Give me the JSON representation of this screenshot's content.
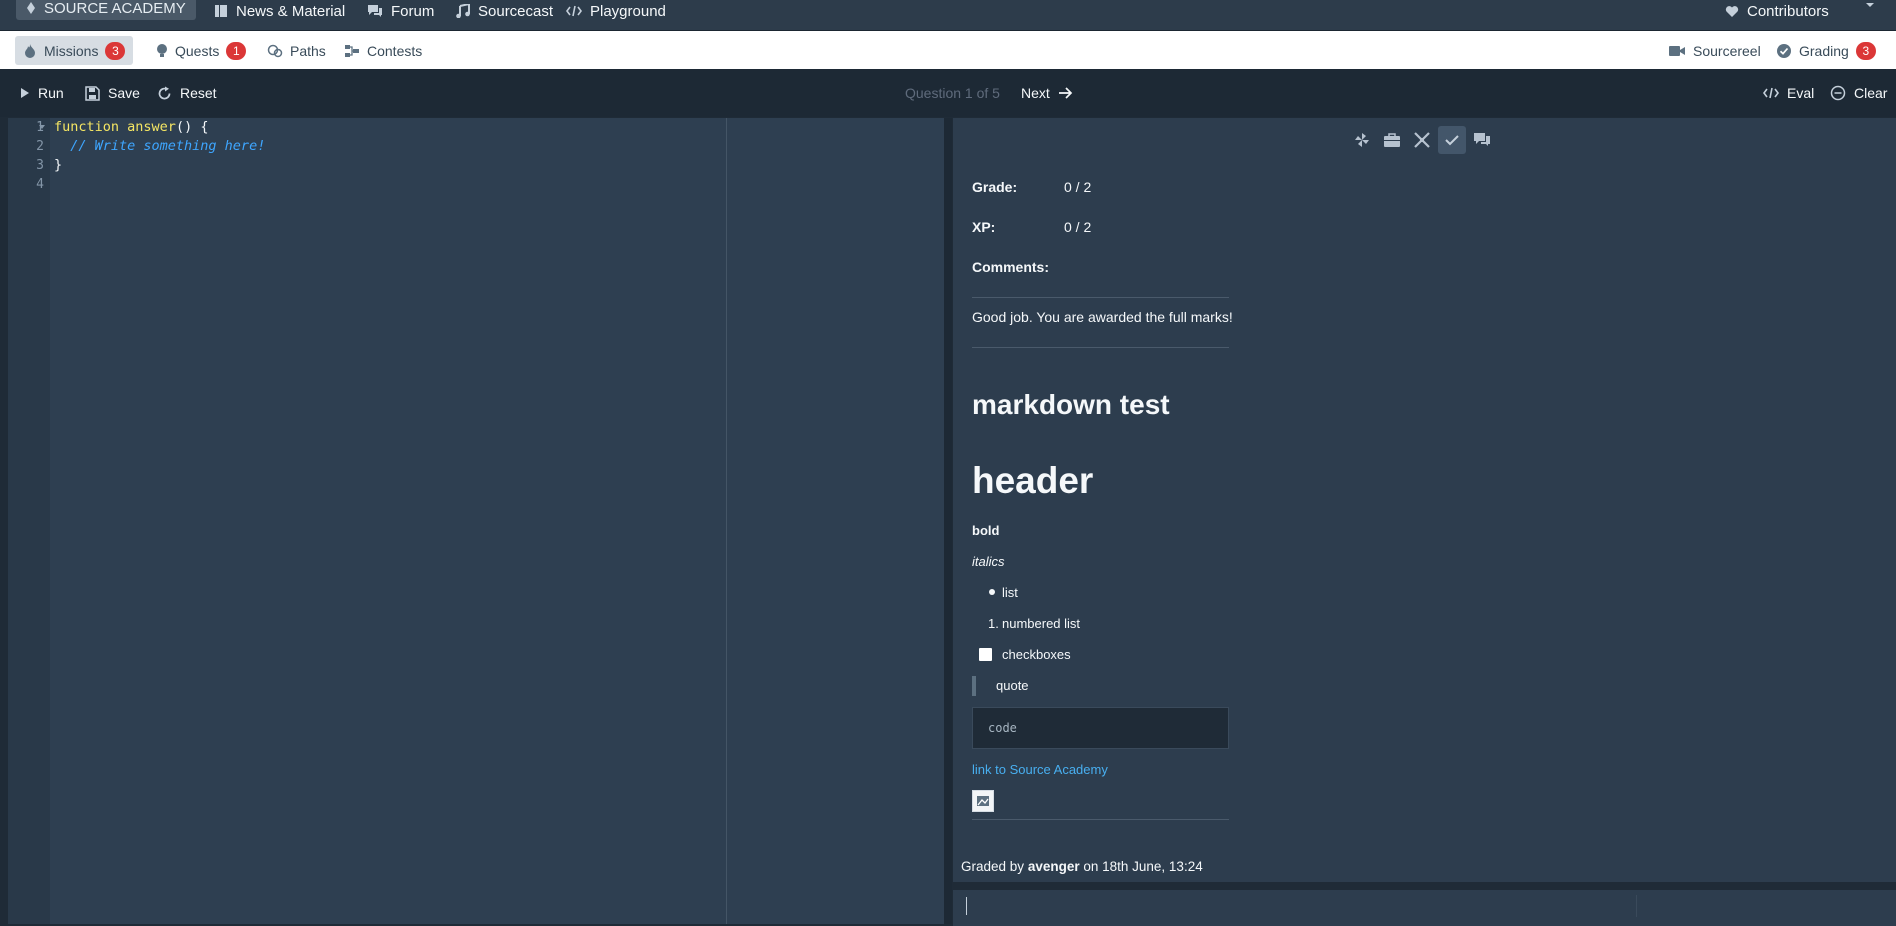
{
  "topnav": {
    "brand": "SOURCE ACADEMY",
    "items": [
      {
        "label": "News & Material"
      },
      {
        "label": "Forum"
      },
      {
        "label": "Sourcecast"
      },
      {
        "label": "Playground"
      }
    ],
    "contributors": "Contributors"
  },
  "subnav": {
    "missions": {
      "label": "Missions",
      "count": "3"
    },
    "quests": {
      "label": "Quests",
      "count": "1"
    },
    "paths": "Paths",
    "contests": "Contests",
    "sourcereel": "Sourcereel",
    "grading": {
      "label": "Grading",
      "count": "3"
    }
  },
  "controls": {
    "run": "Run",
    "save": "Save",
    "reset": "Reset",
    "question_counter": "Question 1 of 5",
    "next": "Next",
    "eval": "Eval",
    "clear": "Clear"
  },
  "editor": {
    "line_numbers": [
      "1",
      "2",
      "3",
      "4"
    ],
    "line1": {
      "keyword": "function",
      "name": "answer",
      "rest": "() {"
    },
    "line2": "  // Write something here!",
    "line3": "}"
  },
  "grading_panel": {
    "grade_label": "Grade:",
    "grade_value": "0 / 2",
    "xp_label": "XP:",
    "xp_value": "0 / 2",
    "comments_label": "Comments:",
    "comment_text": "Good job. You are awarded the full marks!",
    "markdown": {
      "h2": "markdown test",
      "h1": "header",
      "bold": "bold",
      "italics": "italics",
      "bullet": "list",
      "numbered_marker": "1.",
      "numbered": "numbered list",
      "checkbox": "checkboxes",
      "quote": "quote",
      "code": "code",
      "link": "link to Source Academy"
    },
    "graded_by_prefix": "Graded by",
    "grader": "avenger",
    "graded_on": "on 18th June, 13:24"
  },
  "colors": {
    "keyword": "#f5e663",
    "comment": "#3ea6ff",
    "badge": "#db3737",
    "link": "#48aff0"
  }
}
